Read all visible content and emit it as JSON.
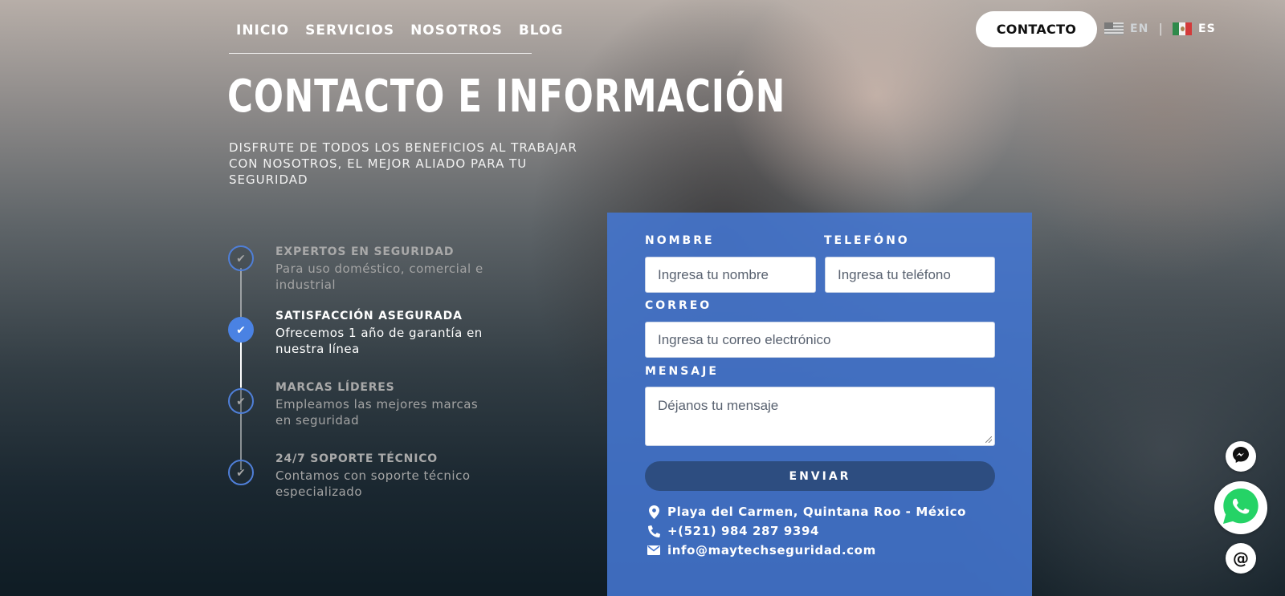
{
  "nav": {
    "items": [
      {
        "label": "INICIO"
      },
      {
        "label": "SERVICIOS"
      },
      {
        "label": "NOSOTROS"
      },
      {
        "label": "BLOG"
      }
    ],
    "contact_label": "CONTACTO",
    "languages": [
      {
        "code": "EN",
        "flag": "us-flag-icon",
        "active": false
      },
      {
        "code": "ES",
        "flag": "mx-flag-icon",
        "active": true
      }
    ],
    "separator": "|"
  },
  "hero": {
    "title": "CONTACTO E INFORMACIÓN",
    "subtitle": "DISFRUTE DE TODOS LOS BENEFICIOS AL TRABAJAR CON NOSOTROS, EL MEJOR ALIADO PARA TU SEGURIDAD"
  },
  "features": [
    {
      "title": "EXPERTOS EN SEGURIDAD",
      "description": "Para uso doméstico, comercial e industrial",
      "active": false,
      "icon": "check-icon"
    },
    {
      "title": "SATISFACCIÓN ASEGURADA",
      "description": "Ofrecemos 1 año de garantía en nuestra línea",
      "active": true,
      "icon": "check-icon"
    },
    {
      "title": "MARCAS LÍDERES",
      "description": "Empleamos las mejores marcas en seguridad",
      "active": false,
      "icon": "check-icon"
    },
    {
      "title": "24/7 SOPORTE TÉCNICO",
      "description": "Contamos con soporte técnico especializado",
      "active": false,
      "icon": "check-icon"
    }
  ],
  "form": {
    "name_label": "NOMBRE",
    "name_placeholder": "Ingresa tu nombre",
    "phone_label": "TELEFÓNO",
    "phone_placeholder": "Ingresa tu teléfono",
    "email_label": "CORREO",
    "email_placeholder": "Ingresa tu correo electrónico",
    "message_label": "MENSAJE",
    "message_placeholder": "Déjanos tu mensaje",
    "submit_label": "ENVIAR",
    "info": {
      "address": "Playa del Carmen, Quintana Roo - México",
      "phone": "+(521) 984 287 9394",
      "email": "info@maytechseguridad.com"
    }
  },
  "floating": {
    "messenger_icon": "messenger-icon",
    "whatsapp_icon": "whatsapp-icon",
    "email_icon": "at-sign-icon",
    "email_glyph": "@"
  },
  "colors": {
    "accent": "#4a82e3",
    "form_panel": "#4476d2",
    "submit_button": "#2d4d80",
    "whatsapp": "#25d366"
  }
}
